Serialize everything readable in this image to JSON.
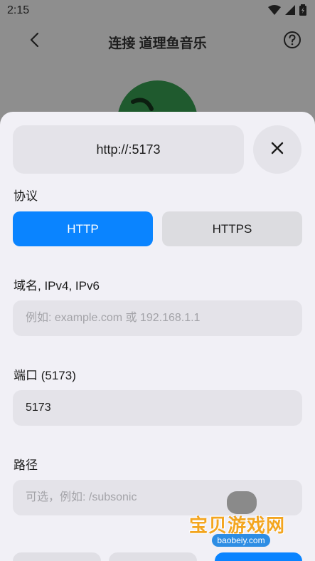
{
  "status_bar": {
    "time": "2:15"
  },
  "app_bar": {
    "title": "连接 道理鱼音乐"
  },
  "sheet": {
    "url_preview": "http://:5173",
    "protocol": {
      "label": "协议",
      "options": [
        "HTTP",
        "HTTPS"
      ],
      "selected": "HTTP"
    },
    "host": {
      "label": "域名, IPv4, IPv6",
      "value": "",
      "placeholder": "例如: example.com 或 192.168.1.1"
    },
    "port": {
      "label": "端口 (5173)",
      "value": "5173",
      "placeholder": ""
    },
    "path": {
      "label": "路径",
      "value": "",
      "placeholder": "可选，例如: /subsonic"
    }
  },
  "watermark": {
    "title": "宝贝游戏网",
    "domain": "baobeiy.com"
  },
  "colors": {
    "accent": "#0a84ff",
    "sheet_bg": "#f1f0f6",
    "field_bg": "#e4e3e9"
  }
}
